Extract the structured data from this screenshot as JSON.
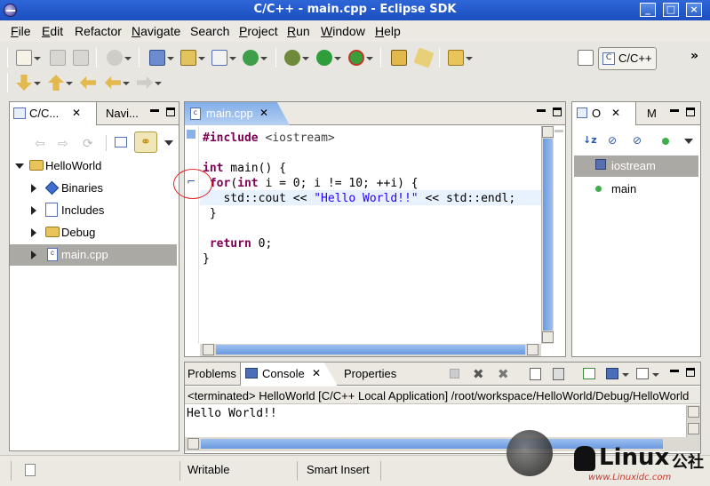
{
  "window": {
    "title": "C/C++ - main.cpp - Eclipse SDK",
    "btn_min": "_",
    "btn_max": "□",
    "btn_close": "×"
  },
  "menu": [
    {
      "label": "File",
      "key": "F",
      "rest": "ile"
    },
    {
      "label": "Edit",
      "key": "E",
      "rest": "dit"
    },
    {
      "label": "Refactor",
      "key": "",
      "rest": "Refactor"
    },
    {
      "label": "Navigate",
      "key": "N",
      "rest": "avigate"
    },
    {
      "label": "Search",
      "key": "",
      "rest": "Search"
    },
    {
      "label": "Project",
      "key": "P",
      "rest": "roject"
    },
    {
      "label": "Run",
      "key": "R",
      "rest": "un"
    },
    {
      "label": "Window",
      "key": "W",
      "rest": "indow"
    },
    {
      "label": "Help",
      "key": "H",
      "rest": "elp"
    }
  ],
  "perspective": {
    "label": "C/C++",
    "more": "»"
  },
  "left_panel": {
    "tab_label": "C/C...",
    "tab2_label": "Navi...",
    "tree": [
      {
        "label": "HelloWorld",
        "level": 0,
        "expanded": true,
        "icon": "project-icon"
      },
      {
        "label": "Binaries",
        "level": 1,
        "icon": "binaries-icon"
      },
      {
        "label": "Includes",
        "level": 1,
        "icon": "includes-icon"
      },
      {
        "label": "Debug",
        "level": 1,
        "icon": "folder-icon"
      },
      {
        "label": "main.cpp",
        "level": 1,
        "icon": "cpp-file-icon",
        "selected": true
      }
    ]
  },
  "editor": {
    "tab_label": "main.cpp",
    "lines": [
      {
        "parts": [
          {
            "t": "#include ",
            "c": "kw"
          },
          {
            "t": "<iostream>",
            "c": "hdr"
          }
        ]
      },
      {
        "parts": []
      },
      {
        "parts": [
          {
            "t": "int",
            "c": "kw"
          },
          {
            "t": " main() {",
            "c": ""
          }
        ]
      },
      {
        "parts": [
          {
            "t": " for",
            "c": "kw"
          },
          {
            "t": "(",
            "c": ""
          },
          {
            "t": "int",
            "c": "kw"
          },
          {
            "t": " i = 0; i != 10; ++i) {",
            "c": ""
          }
        ]
      },
      {
        "parts": [
          {
            "t": "   std::cout << ",
            "c": ""
          },
          {
            "t": "\"Hello World!!\"",
            "c": "str"
          },
          {
            "t": " << std::endl;",
            "c": ""
          }
        ]
      },
      {
        "parts": [
          {
            "t": " }",
            "c": ""
          }
        ]
      },
      {
        "parts": []
      },
      {
        "parts": [
          {
            "t": " ",
            "c": ""
          },
          {
            "t": "return",
            "c": "kw"
          },
          {
            "t": " 0;",
            "c": ""
          }
        ]
      },
      {
        "parts": [
          {
            "t": "}",
            "c": ""
          }
        ]
      }
    ]
  },
  "outline_panel": {
    "tab_label": "O",
    "tab2_label": "M",
    "items": [
      {
        "label": "iostream",
        "icon": "include-icon",
        "selected": true
      },
      {
        "label": "main",
        "icon": "function-icon"
      }
    ]
  },
  "console_panel": {
    "tab_problems": "Problems",
    "tab_console": "Console",
    "tab_properties": "Properties",
    "header": "<terminated> HelloWorld [C/C++ Local Application] /root/workspace/HelloWorld/Debug/HelloWorld",
    "output": "Hello World!!"
  },
  "status": {
    "writable": "Writable",
    "insert_mode": "Smart Insert"
  },
  "watermark": {
    "text1": "Linux",
    "text2": "公社",
    "url": "www.Linuxidc.com"
  },
  "colors": {
    "accent": "#2e66d8",
    "selection": "#aaa9a4",
    "keyword": "#7f0055",
    "string": "#2a00ff"
  }
}
